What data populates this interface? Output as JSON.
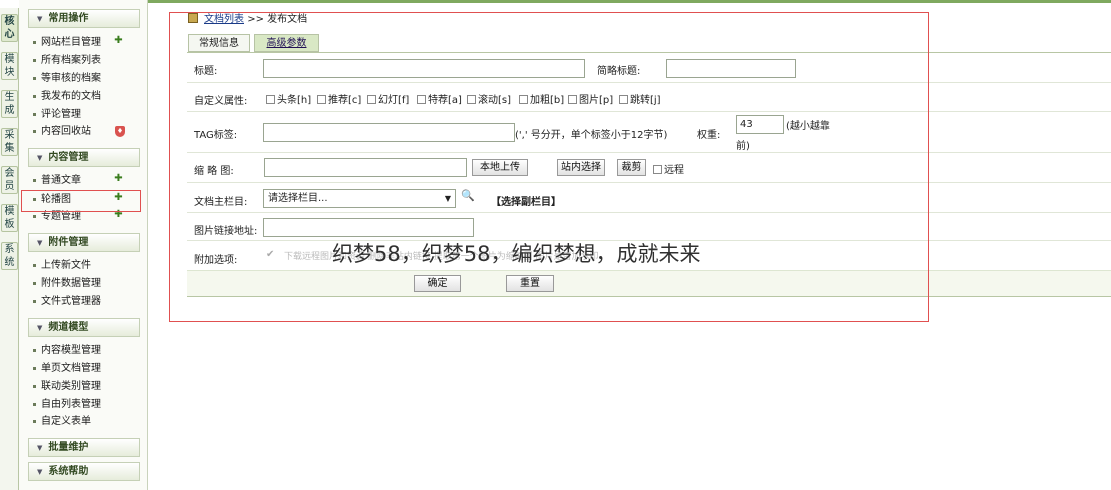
{
  "vtabs": [
    {
      "c1": "核",
      "c2": "心"
    },
    {
      "c1": "模",
      "c2": "块"
    },
    {
      "c1": "生",
      "c2": "成"
    },
    {
      "c1": "采",
      "c2": "集"
    },
    {
      "c1": "会",
      "c2": "员"
    },
    {
      "c1": "模",
      "c2": "板"
    },
    {
      "c1": "系",
      "c2": "统"
    }
  ],
  "sidebar": {
    "g1": "常用操作",
    "g1_items": [
      "网站栏目管理",
      "所有档案列表",
      "等审核的档案",
      "我发布的文档",
      "评论管理",
      "内容回收站"
    ],
    "g2": "内容管理",
    "g2_items": [
      "普通文章",
      "轮播图",
      "专题管理"
    ],
    "g3": "附件管理",
    "g3_items": [
      "上传新文件",
      "附件数据管理",
      "文件式管理器"
    ],
    "g4": "频道模型",
    "g4_items": [
      "内容模型管理",
      "单页文档管理",
      "联动类别管理",
      "自由列表管理",
      "自定义表单"
    ],
    "g5": "批量维护",
    "g6": "系统帮助"
  },
  "breadcrumb": {
    "link": "文档列表",
    "sep": ">>",
    "current": "发布文档"
  },
  "tabs": [
    "常规信息",
    "高级参数"
  ],
  "form": {
    "title_label": "标题:",
    "short_title_label": "简略标题:",
    "attr_label": "自定义属性:",
    "attrs": [
      "头条[h]",
      "推荐[c]",
      "幻灯[f]",
      "特荐[a]",
      "滚动[s]",
      "加粗[b]",
      "图片[p]",
      "跳转[j]"
    ],
    "tag_label": "TAG标签:",
    "tag_hint": "(',' 号分开，单个标签小于12字节)",
    "weight_label": "权重:",
    "weight_value": "43",
    "weight_hint_1": "(越小越靠",
    "weight_hint_2": "前)",
    "thumb_label": "缩 略 图:",
    "btn_local_upload": "本地上传",
    "btn_site_select": "站内选择",
    "btn_crop": "裁剪",
    "remote_label": "远程",
    "main_cat_label": "文档主栏目:",
    "main_cat_placeholder": "请选择栏目...",
    "sub_cat_link": "【选择副栏目】",
    "img_link_label": "图片链接地址:",
    "extra_label": "附加选项:",
    "extra_faint": "下载远程图片和资源    删除非站内链接    提取第一个图片为缩略图    图片是否加水印",
    "btn_ok": "确定",
    "btn_reset": "重置"
  },
  "watermark": "织梦58，织梦58，编织梦想，成就未来"
}
